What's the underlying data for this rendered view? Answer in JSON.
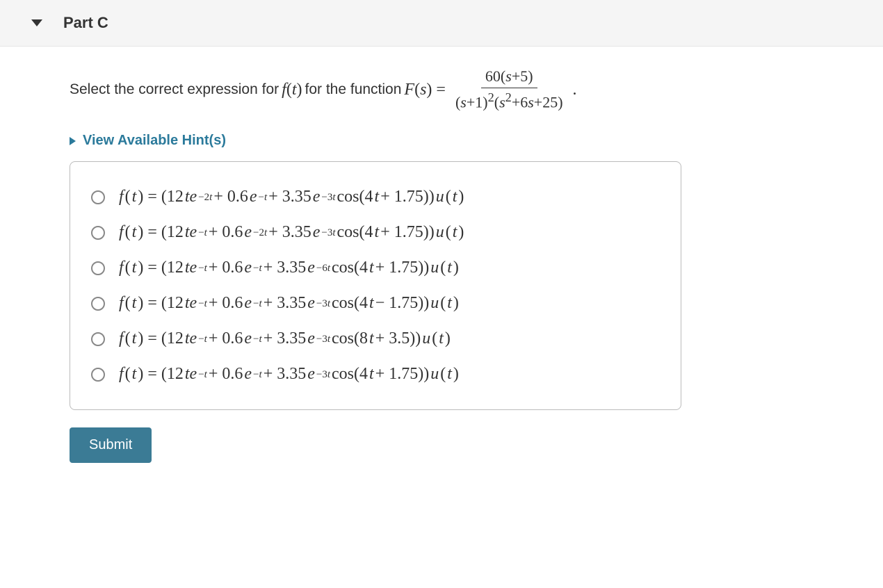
{
  "section": {
    "title": "Part C"
  },
  "prompt": {
    "lead_text": "Select the correct expression for ",
    "f_of_t": "f(t)",
    "mid_text": " for the function ",
    "F_of_s_eq": "F(s) =",
    "numerator": "60(s+5)",
    "denominator": "(s+1)²(s²+6s+25)",
    "tail_text": "."
  },
  "hints": {
    "label": "View Available Hint(s)"
  },
  "options": [
    {
      "prefix": "f(t) = (12te",
      "exp1": "−2t",
      "mid1": " + 0.6e",
      "exp2": "−t",
      "mid2": " + 3.35e",
      "exp3": "−3t",
      "trig": " cos(4t + 1.75))u(t)"
    },
    {
      "prefix": "f(t) = (12te",
      "exp1": "−t",
      "mid1": " + 0.6e",
      "exp2": "−2t",
      "mid2": " + 3.35e",
      "exp3": "−3t",
      "trig": " cos(4t + 1.75))u(t)"
    },
    {
      "prefix": "f(t) = (12te",
      "exp1": "−t",
      "mid1": " + 0.6e",
      "exp2": "−t",
      "mid2": " + 3.35e",
      "exp3": "−6t",
      "trig": " cos(4t + 1.75))u(t)"
    },
    {
      "prefix": "f(t) = (12te",
      "exp1": "−t",
      "mid1": " + 0.6e",
      "exp2": "−t",
      "mid2": " + 3.35e",
      "exp3": "−3t",
      "trig": " cos(4t − 1.75))u(t)"
    },
    {
      "prefix": "f(t) = (12te",
      "exp1": "−t",
      "mid1": " + 0.6e",
      "exp2": "−t",
      "mid2": " + 3.35e",
      "exp3": "−3t",
      "trig": " cos(8t + 3.5))u(t)"
    },
    {
      "prefix": "f(t) = (12te",
      "exp1": "−t",
      "mid1": " + 0.6e",
      "exp2": "−t",
      "mid2": " + 3.35e",
      "exp3": "−3t",
      "trig": " cos(4t + 1.75))u(t)"
    }
  ],
  "submit_label": "Submit"
}
